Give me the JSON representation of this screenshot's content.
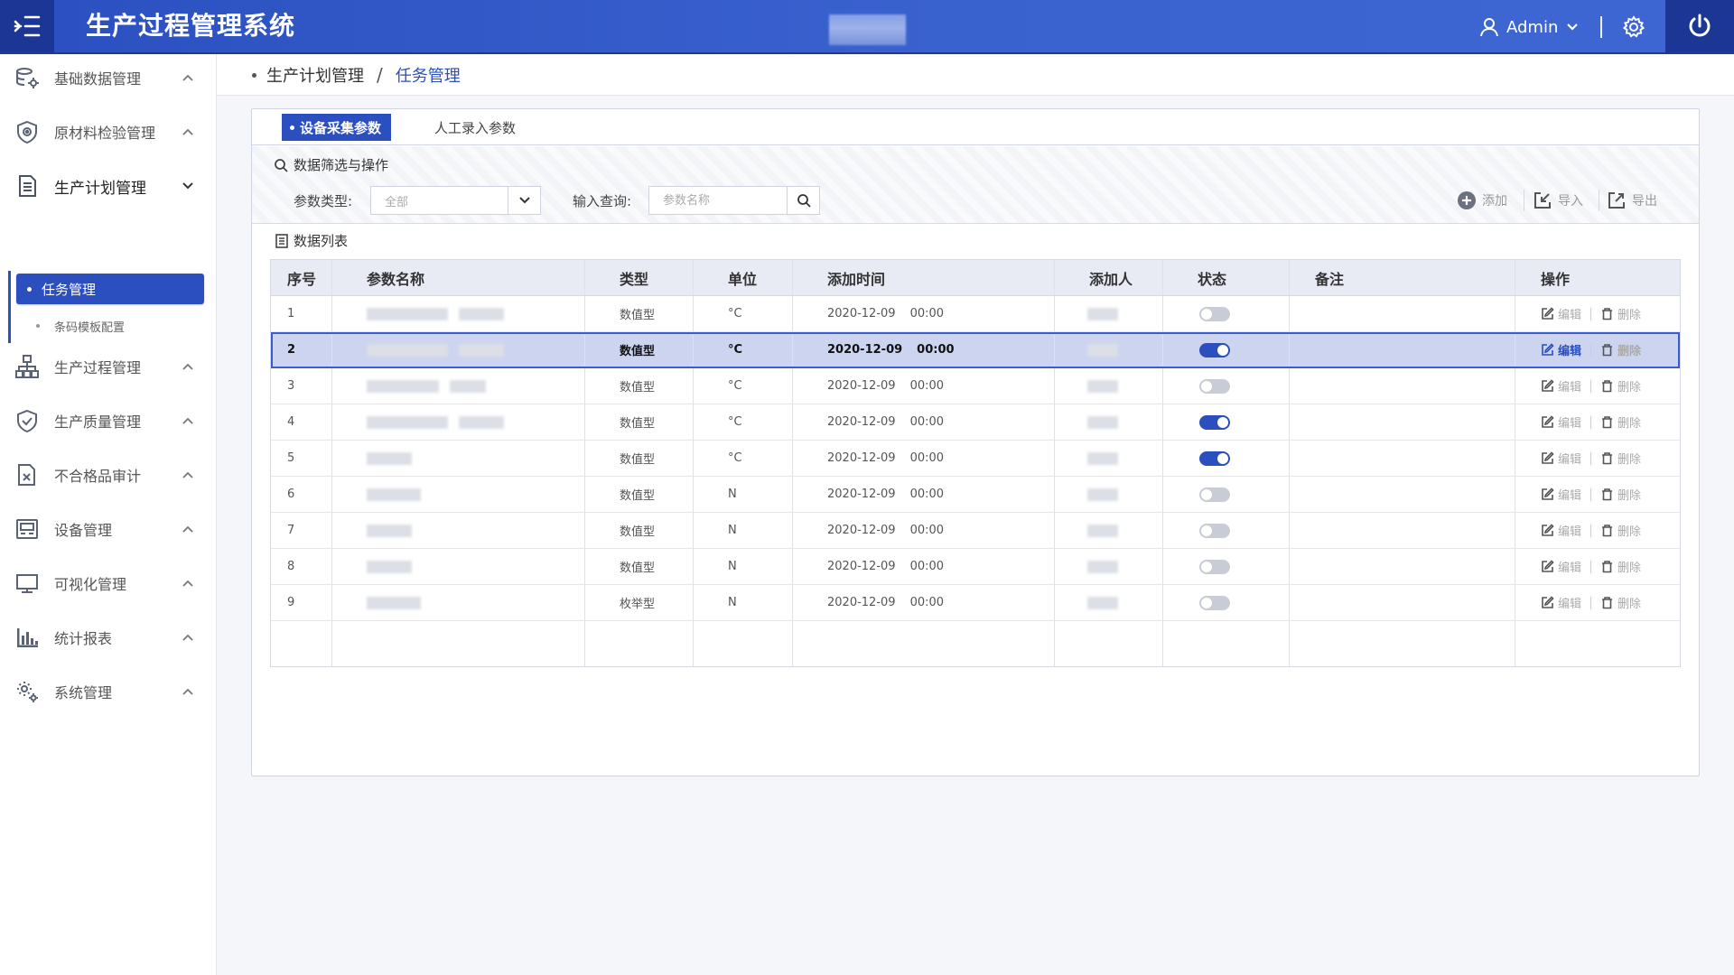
{
  "header": {
    "app_title": "生产过程管理系统",
    "user_name": "Admin"
  },
  "sidebar": {
    "items": [
      {
        "label": "基础数据管理",
        "icon": "database-gear-icon"
      },
      {
        "label": "原材料检验管理",
        "icon": "shield-eye-icon"
      },
      {
        "label": "生产计划管理",
        "icon": "document-icon"
      },
      {
        "label": "生产过程管理",
        "icon": "org-chart-icon"
      },
      {
        "label": "生产质量管理",
        "icon": "shield-check-icon"
      },
      {
        "label": "不合格品审计",
        "icon": "document-x-icon"
      },
      {
        "label": "设备管理",
        "icon": "device-panel-icon"
      },
      {
        "label": "可视化管理",
        "icon": "monitor-icon"
      },
      {
        "label": "统计报表",
        "icon": "bar-chart-icon"
      },
      {
        "label": "系统管理",
        "icon": "gears-icon"
      }
    ],
    "active_sub": "任务管理",
    "sub_item": "条码模板配置"
  },
  "breadcrumb": {
    "parent": "生产计划管理",
    "separator": "/",
    "current": "任务管理"
  },
  "tabs": {
    "active": "设备采集参数",
    "other": "人工录入参数"
  },
  "filter": {
    "title": "数据筛选与操作",
    "type_label": "参数类型:",
    "type_value": "全部",
    "query_label": "输入查询:",
    "query_placeholder": "参数名称",
    "add": "添加",
    "import": "导入",
    "export": "导出"
  },
  "table": {
    "title": "数据列表",
    "headers": [
      "序号",
      "参数名称",
      "类型",
      "单位",
      "添加时间",
      "添加人",
      "状态",
      "备注",
      "操作"
    ],
    "edit_label": "编辑",
    "delete_label": "删除",
    "rows": [
      {
        "no": "1",
        "type": "数值型",
        "unit": "°C",
        "date": "2020-12-09",
        "time": "00:00",
        "status_on": false
      },
      {
        "no": "2",
        "type": "数值型",
        "unit": "°C",
        "date": "2020-12-09",
        "time": "00:00",
        "status_on": true,
        "selected": true
      },
      {
        "no": "3",
        "type": "数值型",
        "unit": "°C",
        "date": "2020-12-09",
        "time": "00:00",
        "status_on": false
      },
      {
        "no": "4",
        "type": "数值型",
        "unit": "°C",
        "date": "2020-12-09",
        "time": "00:00",
        "status_on": true
      },
      {
        "no": "5",
        "type": "数值型",
        "unit": "°C",
        "date": "2020-12-09",
        "time": "00:00",
        "status_on": true
      },
      {
        "no": "6",
        "type": "数值型",
        "unit": "N",
        "date": "2020-12-09",
        "time": "00:00",
        "status_on": false
      },
      {
        "no": "7",
        "type": "数值型",
        "unit": "N",
        "date": "2020-12-09",
        "time": "00:00",
        "status_on": false
      },
      {
        "no": "8",
        "type": "数值型",
        "unit": "N",
        "date": "2020-12-09",
        "time": "00:00",
        "status_on": false
      },
      {
        "no": "9",
        "type": "枚举型",
        "unit": "N",
        "date": "2020-12-09",
        "time": "00:00",
        "status_on": false
      }
    ]
  },
  "colors": {
    "primary": "#2c4fbf",
    "header": "#3a62cf",
    "header_dark": "#1c3696",
    "selected_row": "#ccd4f0"
  }
}
